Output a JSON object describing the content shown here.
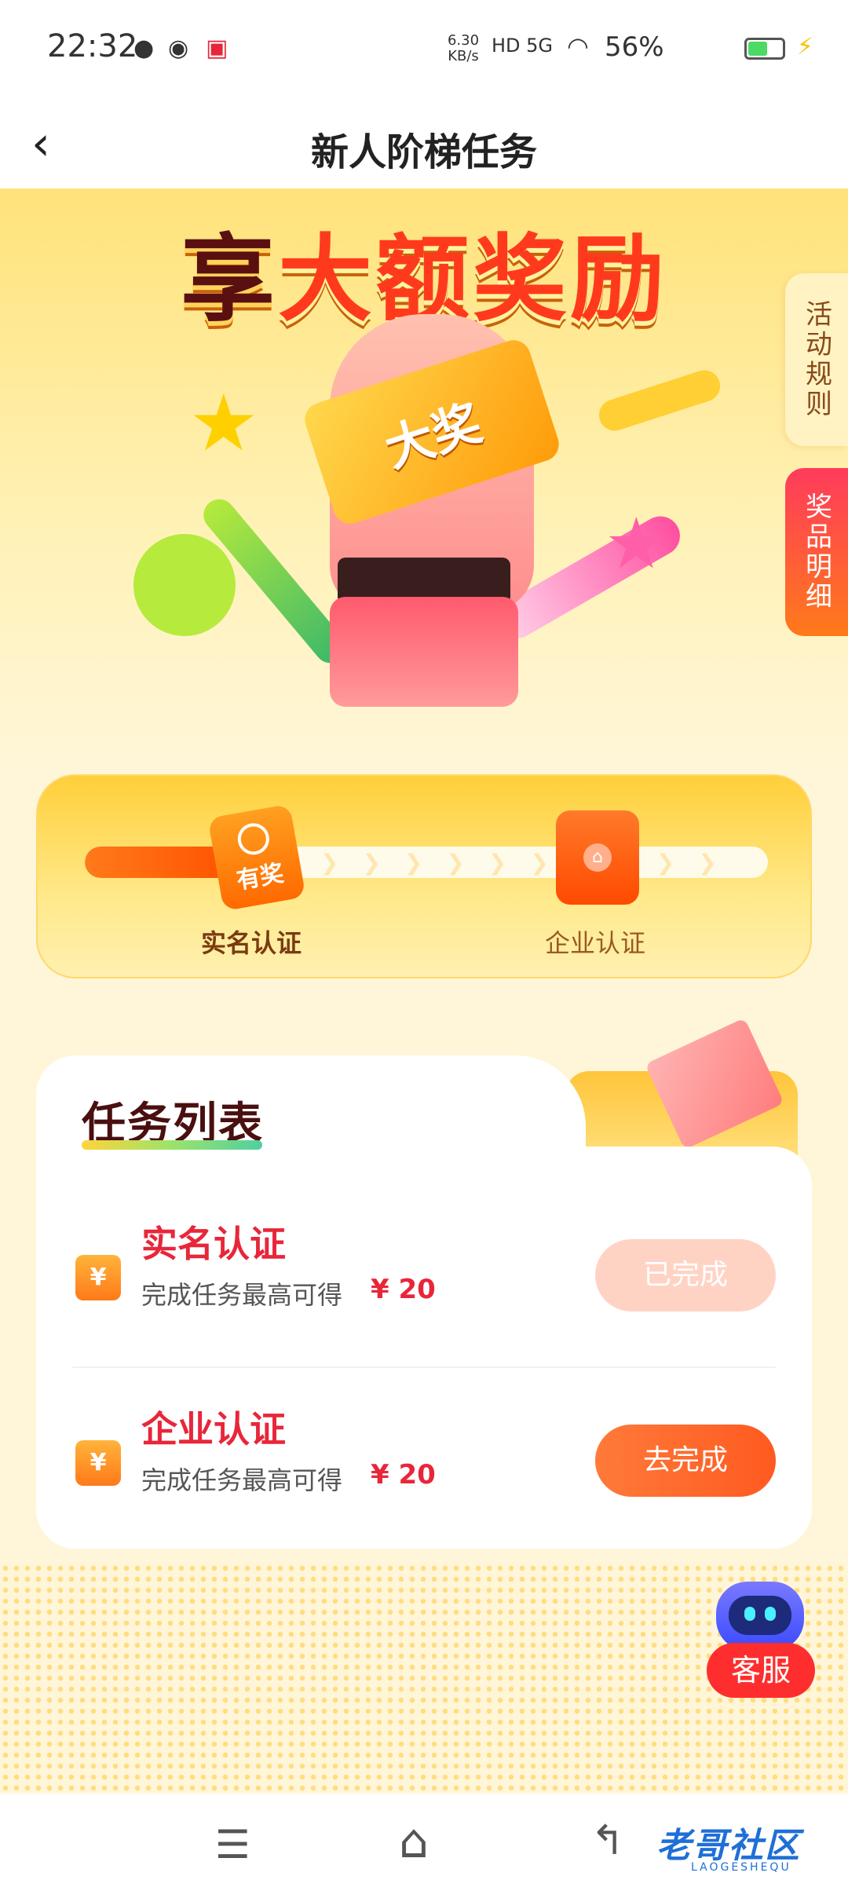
{
  "status_bar": {
    "time": "22:32",
    "net_speed": "6.30 KB/s",
    "network": "HD 5G",
    "battery": "56%",
    "battery_level": 0.56
  },
  "nav": {
    "title": "新人阶梯任务",
    "back_icon": "chevron-left-icon"
  },
  "hero": {
    "title_part1": "享",
    "title_part2": "大额奖励",
    "ticket_text": "大奖"
  },
  "side_tabs": {
    "rules": "活动规则",
    "prizes": "奖品明细"
  },
  "progress": {
    "fraction": 0.22,
    "reward_badge": "有奖",
    "steps": [
      {
        "label": "实名认证"
      },
      {
        "label": "企业认证"
      }
    ]
  },
  "tasks": {
    "title": "任务列表",
    "items": [
      {
        "name": "实名认证",
        "desc": "完成任务最高可得",
        "reward": "¥ 20",
        "button": "已完成",
        "icon": "yen-icon"
      },
      {
        "name": "企业认证",
        "desc": "完成任务最高可得",
        "reward": "¥ 20",
        "button": "去完成",
        "icon": "yen-icon"
      }
    ]
  },
  "customer_service": {
    "label": "客服"
  },
  "watermark": {
    "text": "老哥社区",
    "sub": "LAOGESHEQU"
  },
  "colors": {
    "accent": "#ff5a20",
    "title_red": "#e8263a",
    "done_button": "#ffd3c4"
  }
}
